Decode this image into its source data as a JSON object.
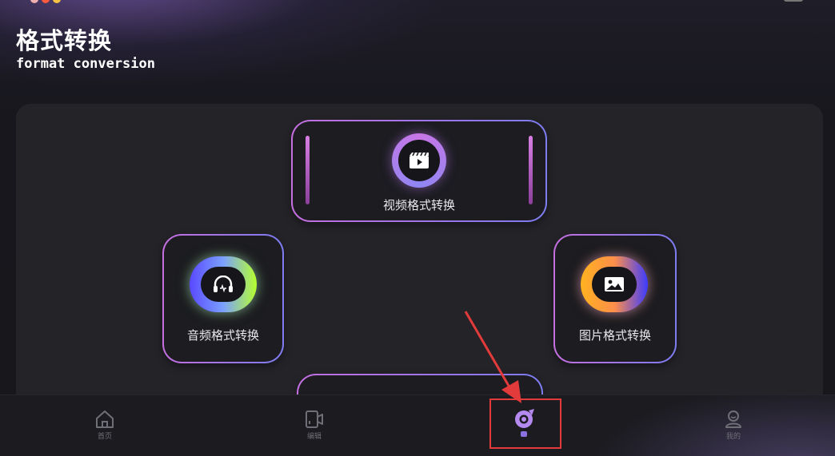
{
  "header": {
    "title": "格式转换",
    "subtitle": "format conversion"
  },
  "cards": {
    "video": {
      "label": "视频格式转换",
      "icon": "video-clapper-icon"
    },
    "audio": {
      "label": "音频格式转换",
      "icon": "headphones-icon"
    },
    "image": {
      "label": "图片格式转换",
      "icon": "image-icon"
    }
  },
  "bottom_nav": {
    "home": {
      "label": "首页",
      "icon": "home-icon"
    },
    "edit": {
      "label": "编辑",
      "icon": "edit-video-icon"
    },
    "convert": {
      "label": "",
      "icon": "convert-icon",
      "active": true
    },
    "mine": {
      "label": "我的",
      "icon": "profile-icon"
    }
  },
  "colors": {
    "accent_purple": "#c876e6",
    "accent_blue": "#7d7cf0",
    "audio_green": "#b6ff2e",
    "image_orange": "#ffb21f",
    "annotation_red": "#e33b3b"
  }
}
